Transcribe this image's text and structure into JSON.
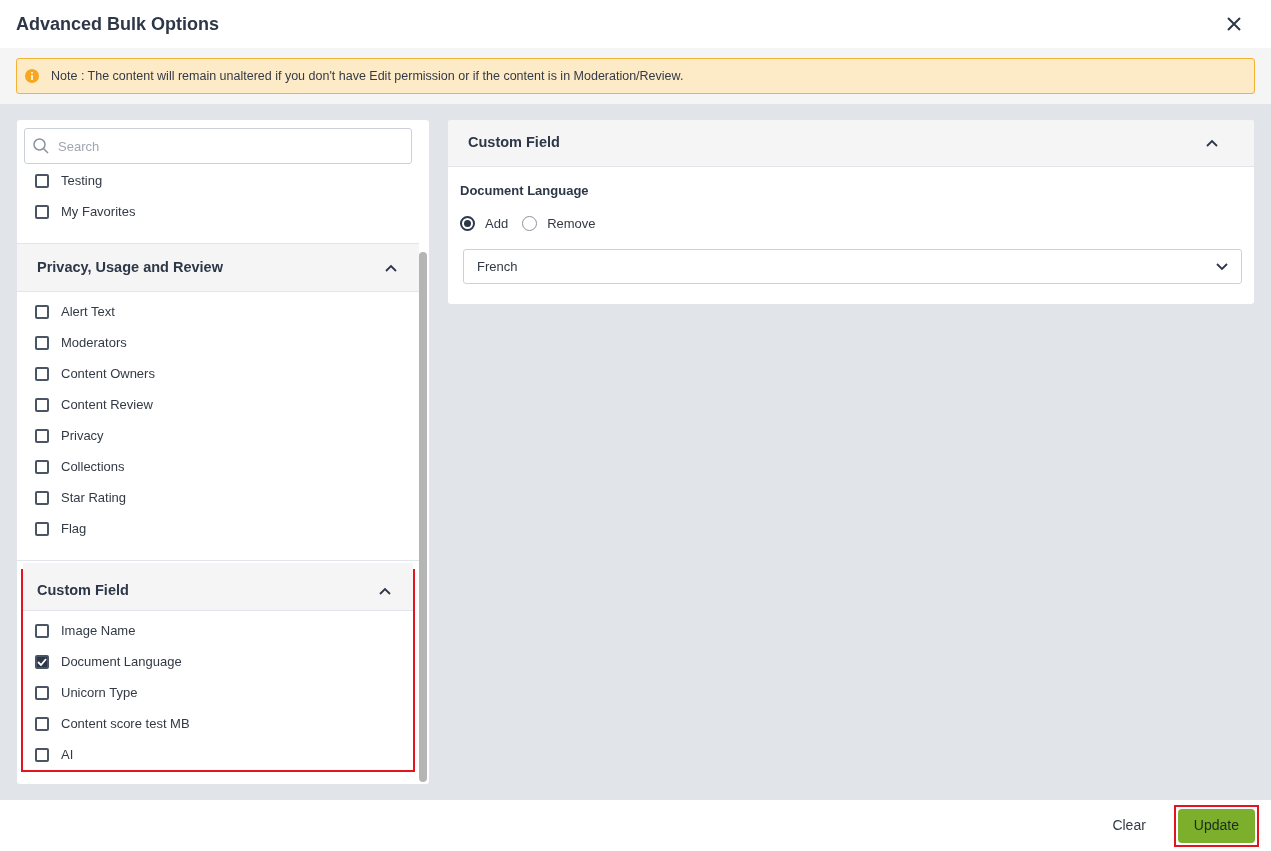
{
  "dialog": {
    "title": "Advanced Bulk Options"
  },
  "note": {
    "text": "Note : The content will remain unaltered if you don't have Edit permission or if the content is in Moderation/Review."
  },
  "left_panel": {
    "search": {
      "placeholder": "Search"
    },
    "items_top": [
      {
        "label": "Testing",
        "checked": false
      },
      {
        "label": "My Favorites",
        "checked": false
      }
    ],
    "sections": [
      {
        "title": "Privacy, Usage and Review",
        "expanded": true,
        "highlighted": false,
        "items": [
          {
            "label": "Alert Text",
            "checked": false
          },
          {
            "label": "Moderators",
            "checked": false
          },
          {
            "label": "Content Owners",
            "checked": false
          },
          {
            "label": "Content Review",
            "checked": false
          },
          {
            "label": "Privacy",
            "checked": false
          },
          {
            "label": "Collections",
            "checked": false
          },
          {
            "label": "Star Rating",
            "checked": false
          },
          {
            "label": "Flag",
            "checked": false
          }
        ]
      },
      {
        "title": "Custom Field",
        "expanded": true,
        "highlighted": true,
        "items": [
          {
            "label": "Image Name",
            "checked": false
          },
          {
            "label": "Document Language",
            "checked": true
          },
          {
            "label": "Unicorn Type",
            "checked": false
          },
          {
            "label": "Content score test MB",
            "checked": false
          },
          {
            "label": "AI",
            "checked": false
          }
        ]
      }
    ]
  },
  "right_panel": {
    "title": "Custom Field",
    "expanded": true,
    "field_label": "Document Language",
    "options": [
      {
        "label": "Add",
        "selected": true
      },
      {
        "label": "Remove",
        "selected": false
      }
    ],
    "select": {
      "value": "French"
    }
  },
  "footer": {
    "buttons": [
      {
        "label": "Clear",
        "kind": "text",
        "highlighted": false
      },
      {
        "label": "Update",
        "kind": "primary",
        "highlighted": true
      }
    ]
  }
}
